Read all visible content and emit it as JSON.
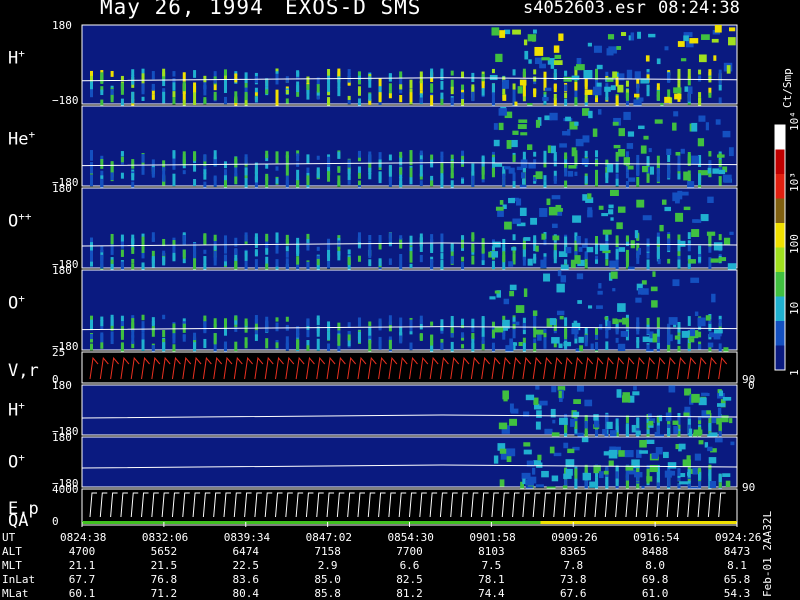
{
  "header": {
    "date": "May 26, 1994",
    "instrument": "EXOS-D SMS",
    "file": "s4052603.esr",
    "time": "08:24:38"
  },
  "colors": {
    "background": "#000000",
    "spectrogram_bg": "#0a1a80",
    "trace_red": "#e83020",
    "trace_white": "#ffffff",
    "qa_green": "#40c020",
    "qa_yellow": "#f0e000"
  },
  "colorbar": {
    "unit": "Ct/Smp",
    "ticks": [
      "1",
      "10",
      "100",
      "10³",
      "10⁴"
    ],
    "stops": [
      "#0a1a80",
      "#1450c0",
      "#20b0d0",
      "#40c040",
      "#a0e020",
      "#f0e000",
      "#806010",
      "#e02010",
      "#c00000",
      "#ffffff"
    ]
  },
  "chart_data": {
    "type": "heatmap",
    "title": "",
    "x_tick_labels": [
      "0824:38",
      "0832:06",
      "0839:34",
      "0847:02",
      "0854:30",
      "0901:58",
      "0909:26",
      "0916:54",
      "0924:26"
    ],
    "panels": [
      {
        "id": "h_plus",
        "label": "H",
        "sup": "+",
        "ytop": "180",
        "ybot": "−180",
        "kind": "spectrogram",
        "trace_level": 0.68
      },
      {
        "id": "he_plus",
        "label": "He",
        "sup": "+",
        "ytop": "",
        "ybot": "−180",
        "kind": "spectrogram",
        "trace_level": 0.72
      },
      {
        "id": "o_plusplus",
        "label": "O",
        "sup": "++",
        "ytop": "180",
        "ybot": "−180",
        "kind": "spectrogram",
        "trace_level": 0.7
      },
      {
        "id": "o_plus",
        "label": "O",
        "sup": "+",
        "ytop": "180",
        "ybot": "−180",
        "kind": "spectrogram",
        "trace_level": 0.72
      },
      {
        "id": "vr",
        "label": "V,r",
        "sup": "",
        "ytop": "25",
        "ybot": "0",
        "rtop": "",
        "rbot": "90",
        "rzero": "0",
        "kind": "trace"
      },
      {
        "id": "h_plus_2",
        "label": "H",
        "sup": "+",
        "ytop": "180",
        "ybot": "−180",
        "kind": "spectrogram2",
        "trace_level": 0.62
      },
      {
        "id": "o_plus_2",
        "label": "O",
        "sup": "+",
        "ytop": "180",
        "ybot": "−180",
        "kind": "spectrogram2",
        "trace_level": 0.58,
        "rtick": "90"
      },
      {
        "id": "ep_qa",
        "label": "E,p",
        "label2": "QA",
        "sup": "",
        "ytop": "4000",
        "ybot": "0",
        "kind": "energy"
      }
    ],
    "table": {
      "rows": [
        {
          "label": "UT",
          "values": [
            "0824:38",
            "0832:06",
            "0839:34",
            "0847:02",
            "0854:30",
            "0901:58",
            "0909:26",
            "0916:54",
            "0924:26"
          ]
        },
        {
          "label": "ALT",
          "values": [
            "4700",
            "5652",
            "6474",
            "7158",
            "7700",
            "8103",
            "8365",
            "8488",
            "8473"
          ]
        },
        {
          "label": "MLT",
          "values": [
            "21.1",
            "21.5",
            "22.5",
            "2.9",
            "6.6",
            "7.5",
            "7.8",
            "8.0",
            "8.1"
          ]
        },
        {
          "label": "InLat",
          "values": [
            "67.7",
            "76.8",
            "83.6",
            "85.0",
            "82.5",
            "78.1",
            "73.8",
            "69.8",
            "65.8"
          ]
        },
        {
          "label": "MLat",
          "values": [
            "60.1",
            "71.2",
            "80.4",
            "85.8",
            "81.2",
            "74.4",
            "67.6",
            "61.0",
            "54.3"
          ]
        }
      ]
    }
  },
  "footer": {
    "side_note": "Feb-01 2AA32L"
  }
}
